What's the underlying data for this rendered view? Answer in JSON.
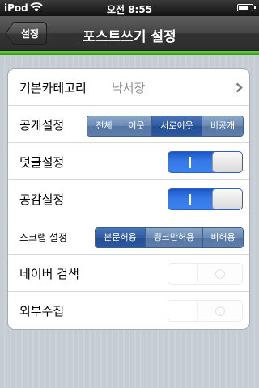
{
  "statusbar": {
    "carrier": "iPod",
    "time": "오전 8:55",
    "battery_level": 0.75
  },
  "navbar": {
    "back_label": "설정",
    "title": "포스트쓰기 설정"
  },
  "settings": {
    "category": {
      "label": "기본카테고리",
      "value": "낙서장"
    },
    "visibility": {
      "label": "공개설정",
      "options": [
        "전체",
        "이웃",
        "서로이웃",
        "비공개"
      ],
      "selected": "서로이웃"
    },
    "comments": {
      "label": "덧글설정",
      "on": true
    },
    "empathy": {
      "label": "공감설정",
      "on": true
    },
    "scrap": {
      "label": "스크랩 설정",
      "options": [
        "본문허용",
        "링크만허용",
        "비허용"
      ],
      "selected": "본문허용"
    },
    "naver_search": {
      "label": "네이버 검색",
      "on": false
    },
    "external_collect": {
      "label": "외부수집",
      "on": false
    }
  },
  "colors": {
    "nav_green": "#3fa81a",
    "segment_selected": "#2b58a0",
    "switch_on": "#3579e6"
  },
  "icons": {
    "wifi": "wifi-icon",
    "battery": "battery-icon",
    "chevron": "chevron-right-icon"
  }
}
